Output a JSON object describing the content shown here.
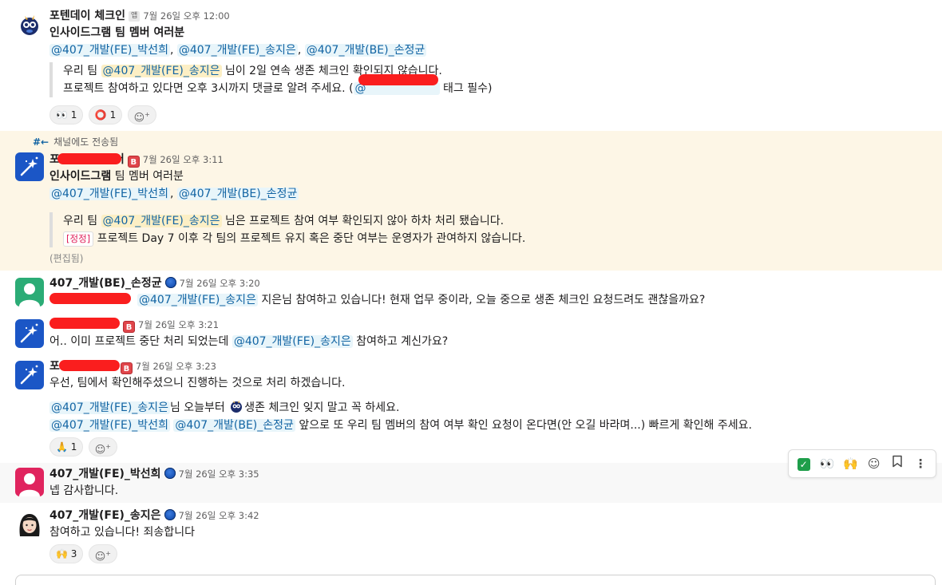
{
  "messages": {
    "m1": {
      "author": "포텐데이 체크인",
      "app_badge": "앱",
      "time": "7월 26일 오후 12:00",
      "title": "인사이드그램 팀 멤버 여러분",
      "mentions": [
        "@407_개발(FE)_박선희",
        "@407_개발(FE)_송지은",
        "@407_개발(BE)_손정균"
      ],
      "comma": ",",
      "quote_line1_prefix": "우리 팀 ",
      "quote_line1_mention": "@407_개발(FE)_송지은",
      "quote_line1_suffix": " 님이 2일 연속 생존 체크인 확인되지 않습니다.",
      "quote_line2_prefix": "프로젝트 참여하고 있다면 오후 3시까지 댓글로 알려 주세요. (",
      "quote_line2_mention": "@",
      "quote_line2_suffix": " 태그 필수)",
      "reactions": [
        {
          "emoji": "👀",
          "count": "1"
        },
        {
          "emoji": "⭕",
          "count": "1"
        }
      ]
    },
    "m2": {
      "forward_note": "채널에도 전송됨",
      "author_visible": "포",
      "author_tail": "어",
      "badge": "B",
      "time": "7월 26일 오후 3:11",
      "title_bold": "인사이드그램",
      "title_rest": " 팀 멤버 여러분",
      "mentions": [
        "@407_개발(FE)_박선희",
        "@407_개발(BE)_손정균"
      ],
      "comma": ",",
      "quote_line1_prefix": "우리 팀 ",
      "quote_line1_mention": "@407_개발(FE)_송지은",
      "quote_line1_suffix": " 님은 프로젝트 참여 여부 확인되지 않아 하차 처리 됐습니다.",
      "quote_tag": "[정정]",
      "quote_line2": " 프로젝트 Day 7 이후 각 팀의 프로젝트 유지 혹은 중단 여부는 운영자가 관여하지 않습니다.",
      "edited": "(편집됨)"
    },
    "m3": {
      "author": "407_개발(BE)_손정균",
      "time": "7월 26일 오후 3:20",
      "mention": "@407_개발(FE)_송지은",
      "text": " 지은님 참여하고 있습니다! 현재 업무 중이라, 오늘 중으로  생존 체크인 요청드려도 괜찮을까요?"
    },
    "m4": {
      "badge": "B",
      "time": "7월 26일 오후 3:21",
      "text_prefix": "어.. 이미 프로젝트 중단 처리 되었는데 ",
      "mention": "@407_개발(FE)_송지은",
      "text_suffix": " 참여하고 계신가요?"
    },
    "m5": {
      "author_visible": "포",
      "badge": "B",
      "time": "7월 26일 오후 3:23",
      "line1": "우선, 팀에서 확인해주셨으니 진행하는 것으로 처리 하겠습니다.",
      "line2_mention": "@407_개발(FE)_송지은",
      "line2_text": "님 오늘부터 ",
      "line2_text2": "생존 체크인 잊지 말고 꼭 하세요.",
      "line3_mentions": [
        "@407_개발(FE)_박선희",
        "@407_개발(BE)_손정균"
      ],
      "line3_text": " 앞으로 또 우리 팀 멤버의 참여 여부 확인 요청이 온다면(안 오길 바라며...) 빠르게 확인해 주세요.",
      "reactions": [
        {
          "emoji": "🙏",
          "count": "1"
        }
      ]
    },
    "m6": {
      "author": "407_개발(FE)_박선희",
      "time": "7월 26일 오후 3:35",
      "text": "넵 감사합니다."
    },
    "m7": {
      "author": "407_개발(FE)_송지은",
      "time": "7월 26일 오후 3:42",
      "text": "참여하고 있습니다! 죄송합니다",
      "reactions": [
        {
          "emoji": "🙌",
          "count": "3"
        }
      ]
    }
  },
  "toolbar": {
    "check_glyph": "✓",
    "eyes": "👀",
    "raised_hands": "🙌",
    "add_reaction": "☺",
    "bookmark": "🔖",
    "more": "⋮"
  },
  "colors": {
    "mention_text": "#1264a3",
    "highlight_bg": "#fdf6e6",
    "redaction": "#fa1e1e",
    "app_avatar": "#1b56c6"
  }
}
